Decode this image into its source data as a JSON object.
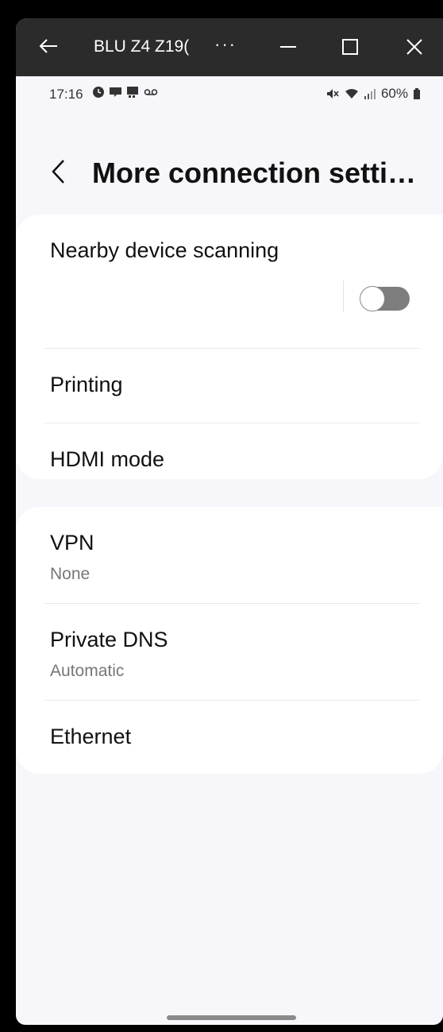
{
  "window": {
    "title": "BLU Z4 Z19(",
    "more_label": "···"
  },
  "status_bar": {
    "time": "17:16",
    "battery": "60%"
  },
  "header": {
    "title": "More connection setti…"
  },
  "section1": {
    "nearby": {
      "label": "Nearby device scanning",
      "toggle_on": false
    },
    "printing": {
      "label": "Printing"
    },
    "hdmi": {
      "label": "HDMI mode"
    }
  },
  "section2": {
    "vpn": {
      "label": "VPN",
      "value": "None"
    },
    "dns": {
      "label": "Private DNS",
      "value": "Automatic"
    },
    "ethernet": {
      "label": "Ethernet"
    }
  },
  "colors": {
    "background": "#f7f6fa",
    "card": "#ffffff",
    "toggle_off": "#7d7d7d",
    "titlebar": "#2b2b2b"
  }
}
